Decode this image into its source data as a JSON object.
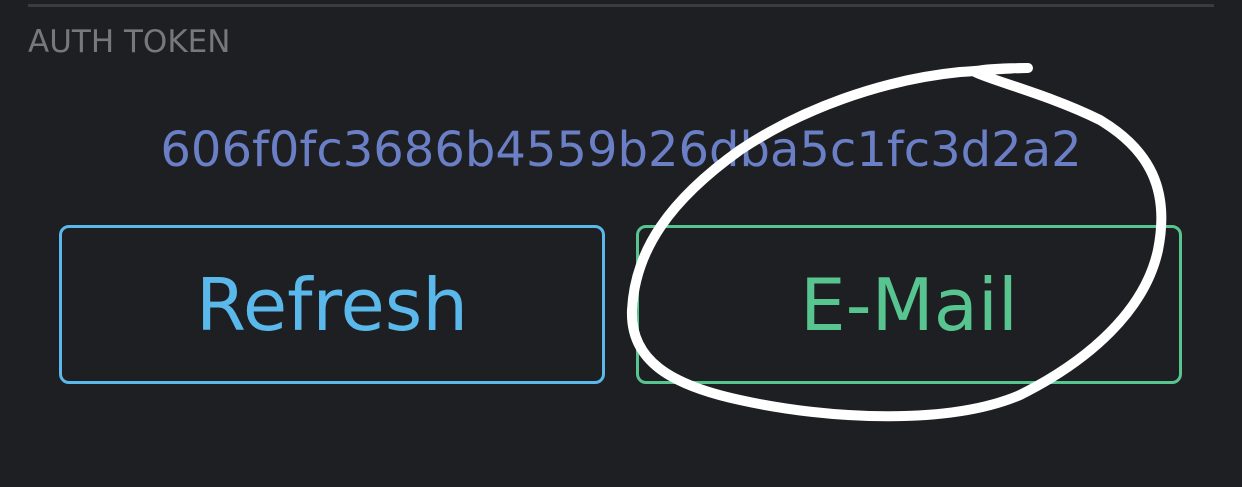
{
  "section": {
    "label": "AUTH TOKEN"
  },
  "token": {
    "value": "606f0fc3686b4559b26dba5c1fc3d2a2",
    "color": "#6a7fc6"
  },
  "buttons": {
    "refresh": {
      "label": "Refresh",
      "color": "#5ab8ea"
    },
    "email": {
      "label": "E-Mail",
      "color": "#58c48f"
    }
  },
  "annotation": {
    "type": "hand-drawn-circle",
    "color": "#ffffff",
    "target": "email-button"
  },
  "colors": {
    "background": "#1e1f23",
    "label": "#76787c",
    "divider": "#3a3b40"
  }
}
